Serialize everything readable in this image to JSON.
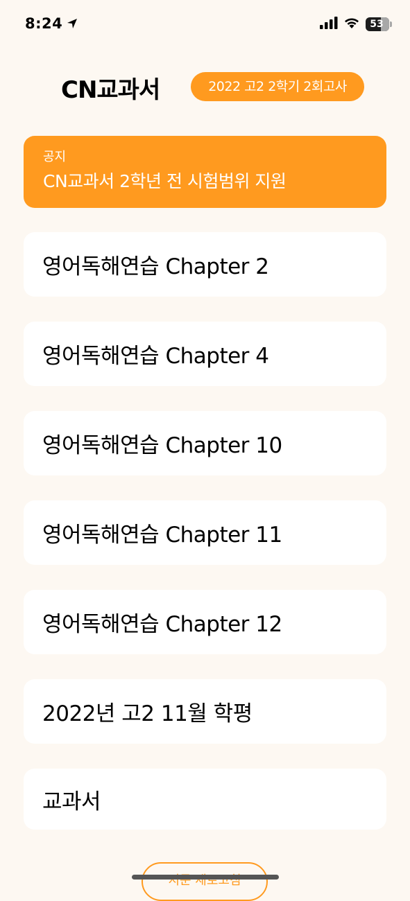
{
  "status_bar": {
    "time": "8:24",
    "battery": "53"
  },
  "header": {
    "title": "CN교과서",
    "exam_badge": "2022 고2 2학기 2회고사"
  },
  "notice": {
    "label": "공지",
    "text": "CN교과서 2학년 전 시험범위 지원"
  },
  "list": {
    "items": [
      "영어독해연습 Chapter 2",
      "영어독해연습 Chapter 4",
      "영어독해연습 Chapter 10",
      "영어독해연습 Chapter 11",
      "영어독해연습 Chapter 12",
      "2022년 고2 11월 학평",
      "교과서"
    ]
  },
  "bottom": {
    "refresh_label": "지문 새로고침"
  },
  "colors": {
    "accent": "#ff9a1f",
    "background": "#fdf8f2",
    "card": "#ffffff"
  }
}
